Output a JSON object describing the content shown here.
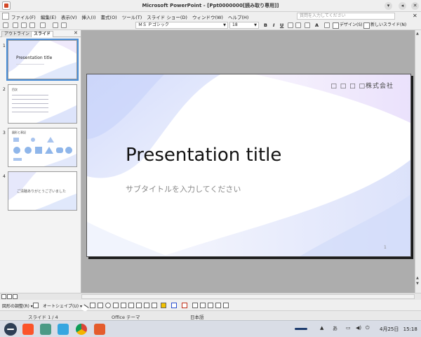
{
  "window": {
    "title": "Microsoft PowerPoint - [Ppt0000000[読み取り専用]]",
    "minimize": "▾",
    "restore": "◂",
    "close": "✕"
  },
  "menubar": {
    "items": [
      "ファイル(F)",
      "編集(E)",
      "表示(V)",
      "挿入(I)",
      "書式(O)",
      "ツール(T)",
      "スライド ショー(D)",
      "ウィンドウ(W)",
      "ヘルプ(H)"
    ],
    "help_placeholder": "質問を入力してください",
    "close": "✕"
  },
  "toolbar": {
    "font_name": "ＭＳ Ｐゴシック",
    "font_size": "18",
    "bold": "B",
    "italic": "I",
    "underline": "U",
    "font_grow": "A",
    "design_label": "デザイン(S)",
    "new_slide_label": "新しいスライド(N)"
  },
  "leftpane": {
    "tab_outline": "アウトライン",
    "tab_slides": "スライド",
    "close": "✕",
    "slides": [
      {
        "num": "1",
        "title": "Presentation title"
      },
      {
        "num": "2",
        "title": "目次"
      },
      {
        "num": "3",
        "title": "図形と表記"
      },
      {
        "num": "4",
        "message": "ご清聴ありがとうございました"
      }
    ]
  },
  "slide": {
    "company": "□ □ □ □株式会社",
    "title": "Presentation title",
    "subtitle": "サブタイトルを入力してください",
    "page_number": "1"
  },
  "drawbar": {
    "draw_label": "図形の調整(R) ▾",
    "autoshape_label": "オートシェイプ(U) ▾"
  },
  "statusbar": {
    "slide_pos": "スライド 1 / 4",
    "theme": "Office テーマ",
    "language": "日本語"
  },
  "taskbar": {
    "ime": "あ",
    "date": "4月25日",
    "time": "15:18"
  }
}
